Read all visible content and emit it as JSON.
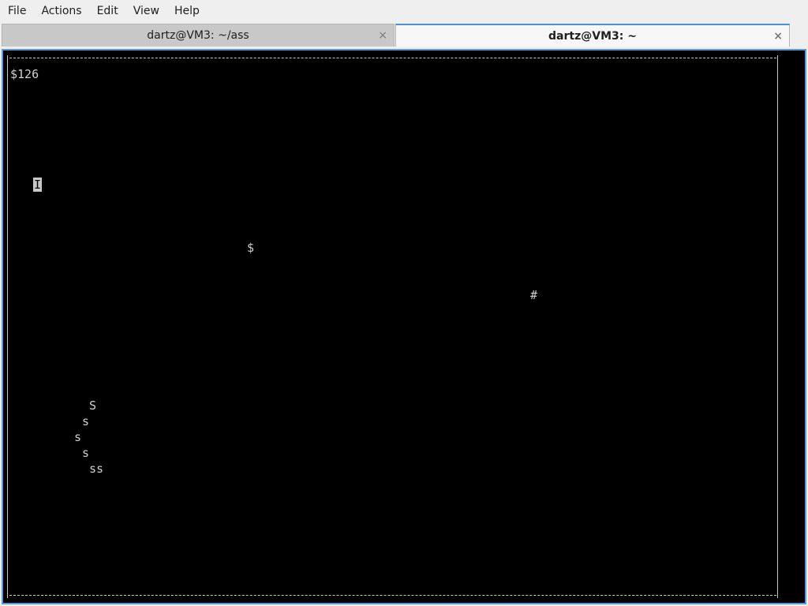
{
  "menubar": {
    "items": [
      "File",
      "Actions",
      "Edit",
      "View",
      "Help"
    ]
  },
  "tabs": [
    {
      "label": "dartz@VM3: ~/ass",
      "active": false,
      "close_icon": "close-icon"
    },
    {
      "label": "dartz@VM3: ~",
      "active": true,
      "close_icon": "close-icon"
    }
  ],
  "tab_close_glyph": "×",
  "terminal": {
    "background": "#000000",
    "foreground": "#d0d0d0",
    "accent": "#5a9ad8",
    "money": "$126",
    "player": "I",
    "dollar": "$",
    "hash": "#",
    "snake": {
      "head": "S",
      "segments": [
        "s",
        "s",
        "s",
        "ss"
      ]
    }
  }
}
